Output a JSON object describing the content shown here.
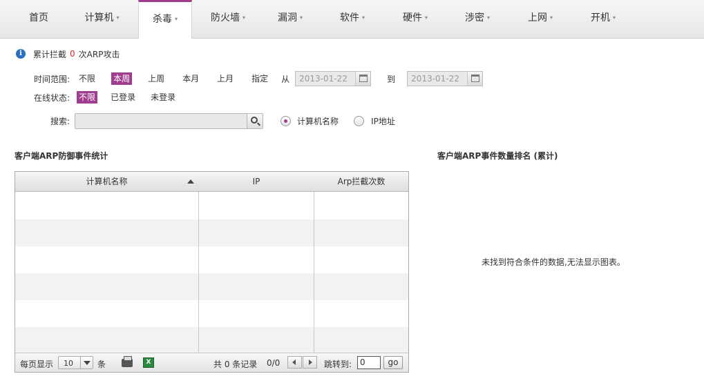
{
  "nav": {
    "tabs": [
      {
        "label": "首页",
        "has_arrow": false
      },
      {
        "label": "计算机",
        "has_arrow": true
      },
      {
        "label": "杀毒",
        "has_arrow": true,
        "active": true
      },
      {
        "label": "防火墙",
        "has_arrow": true
      },
      {
        "label": "漏洞",
        "has_arrow": true
      },
      {
        "label": "软件",
        "has_arrow": true
      },
      {
        "label": "硬件",
        "has_arrow": true
      },
      {
        "label": "涉密",
        "has_arrow": true
      },
      {
        "label": "上网",
        "has_arrow": true
      },
      {
        "label": "开机",
        "has_arrow": true
      }
    ],
    "arrow_glyph": "▾",
    "accent_color": "#a13d8e"
  },
  "summary": {
    "prefix": "累计拦截",
    "count": "0",
    "suffix": "次ARP攻击",
    "icon": "info-icon"
  },
  "time_filter": {
    "label": "时间范围:",
    "options": [
      "不限",
      "本周",
      "上周",
      "本月",
      "上月",
      "指定"
    ],
    "selected": "本周",
    "from_label": "从",
    "from_value": "2013-01-22",
    "to_label": "到",
    "to_value": "2013-01-22"
  },
  "status_filter": {
    "label": "在线状态:",
    "options": [
      "不限",
      "已登录",
      "未登录"
    ],
    "selected": "不限"
  },
  "search": {
    "label": "搜索:",
    "value": "",
    "radio_options": [
      "计算机名称",
      "IP地址"
    ],
    "selected": "计算机名称"
  },
  "left_section": {
    "title": "客户端ARP防御事件统计",
    "columns": [
      "计算机名称",
      "IP",
      "Arp拦截次数"
    ],
    "sorted_column": "计算机名称",
    "rows": []
  },
  "pager": {
    "per_page_label": "每页显示",
    "per_page_value": "10",
    "per_page_unit": "条",
    "total_text": "共 0 条记录",
    "page_text": "0/0",
    "jump_label": "跳转到:",
    "jump_value": "0",
    "go_label": "go"
  },
  "right_section": {
    "title": "客户端ARP事件数量排名 (累计)",
    "empty_message": "未找到符合条件的数据,无法显示图表。"
  }
}
